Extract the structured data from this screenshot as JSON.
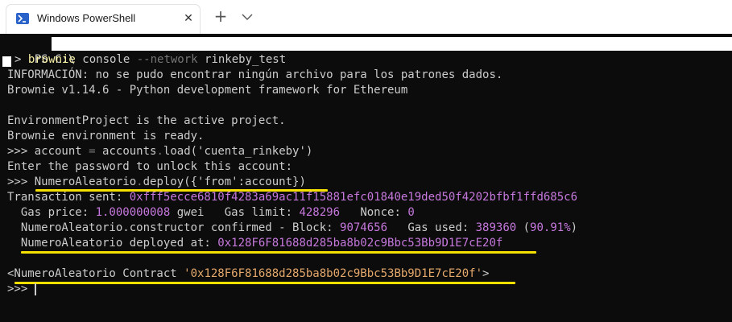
{
  "window": {
    "tab_title": "Windows PowerShell",
    "close_glyph": "✕",
    "new_tab_glyph": "+"
  },
  "icons": {
    "tab_icon": "powershell-icon",
    "dropdown": "chevron-down-icon"
  },
  "colors": {
    "accent": "#2962c9",
    "highlight": "#f5e000",
    "number": "#c678dd",
    "string": "#e5a86b"
  },
  "terminal": {
    "prompt_path": "PS C:\\",
    "cmd1": {
      "arrow": "> ",
      "word1": "brownie",
      "word2": " console ",
      "flag": "--network",
      "arg": " rinkeby_test"
    },
    "info": "INFORMACIÓN: no se pudo encontrar ningún archivo para los patrones dados.",
    "version": "Brownie v1.14.6 - Python development framework for Ethereum",
    "active": "EnvironmentProject is the active project.",
    "ready": "Brownie environment is ready.",
    "load": {
      "prompt": ">>> ",
      "a": "account",
      "eq": " = ",
      "b": "accounts",
      "dot": ".",
      "c": "load('cuenta_rinkeby')"
    },
    "password": "Enter the password to unlock this account:",
    "deploy": {
      "prompt": ">>> ",
      "a": "NumeroAleatorio",
      "dot": ".",
      "b": "deploy({'from':account})"
    },
    "tx": {
      "label": "Transaction sent: ",
      "hash": "0xfff5ecce6810f4283a69ac11f15881efc01840e19ded50f4202bfbf1ffd685c6"
    },
    "gas": {
      "l1": "  Gas price: ",
      "v1": "1.000000008",
      "l2": " gwei   Gas limit: ",
      "v2": "428296",
      "l3": "   Nonce: ",
      "v3": "0"
    },
    "confirmed": {
      "l1": "  NumeroAleatorio.constructor confirmed - Block: ",
      "v1": "9074656",
      "l2": "   Gas used: ",
      "v2": "389360",
      "l3": " (",
      "v3": "90.91%",
      "l4": ")"
    },
    "deployed": {
      "label": "  NumeroAleatorio deployed at: ",
      "addr": "0x128F6F81688d285ba8b02c9Bbc53Bb9D1E7cE20f"
    },
    "contract": {
      "open": "<NumeroAleatorio Contract ",
      "addr": "'0x128F6F81688d285ba8b02c9Bbc53Bb9D1E7cE20f'",
      "close": ">"
    },
    "final_prompt": ">>> "
  }
}
